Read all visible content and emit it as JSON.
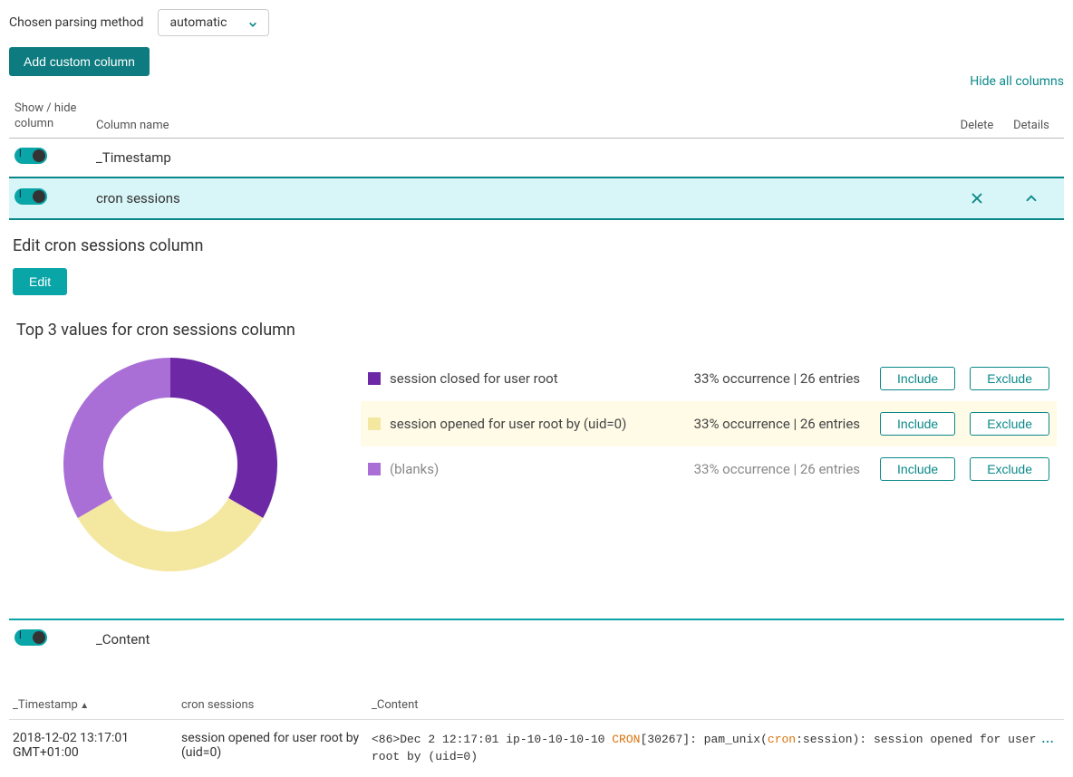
{
  "parse": {
    "label": "Chosen parsing method",
    "selected": "automatic"
  },
  "buttons": {
    "add_custom": "Add custom column",
    "hide_all": "Hide all columns",
    "edit": "Edit",
    "include": "Include",
    "exclude": "Exclude"
  },
  "column_list": {
    "headers": {
      "showhide": "Show / hide column",
      "name": "Column name",
      "delete": "Delete",
      "details": "Details"
    },
    "rows": [
      {
        "name": "_Timestamp",
        "selected": false,
        "deletable": false
      },
      {
        "name": "cron sessions",
        "selected": true,
        "deletable": true
      },
      {
        "name": "_Content",
        "selected": false,
        "deletable": false
      }
    ]
  },
  "edit_section": {
    "title": "Edit cron sessions column"
  },
  "top3": {
    "title": "Top 3 values for cron sessions column",
    "rows": [
      {
        "label": "session closed for user root",
        "stats": "33% occurrence | 26 entries",
        "color": "#6d28a5",
        "highlight": false,
        "muted": false
      },
      {
        "label": "session opened for user root by (uid=0)",
        "stats": "33% occurrence | 26 entries",
        "color": "#f4e7a0",
        "highlight": true,
        "muted": false
      },
      {
        "label": "(blanks)",
        "stats": "33% occurrence | 26 entries",
        "color": "#a96fd6",
        "highlight": false,
        "muted": true
      }
    ]
  },
  "data_table": {
    "headers": {
      "ts": "_Timestamp",
      "cron": "cron sessions",
      "content": "_Content"
    },
    "row": {
      "ts": "2018-12-02 13:17:01 GMT+01:00",
      "cron": "session opened for user root by (uid=0)",
      "c1": "<86>Dec  2 12:17:01 ip-10-10-10-10   ",
      "c2": "CRON",
      "c3": "[30267]:  pam_unix(",
      "c4": "cron",
      "c5": ":session): session opened for user root by (uid=0)"
    }
  },
  "chart_data": {
    "type": "pie",
    "inner_radius_ratio": 0.62,
    "series": [
      {
        "name": "session closed for user root",
        "value": 33.3,
        "entries": 26,
        "color": "#6d28a5"
      },
      {
        "name": "session opened for user root by (uid=0)",
        "value": 33.3,
        "entries": 26,
        "color": "#f4e7a0"
      },
      {
        "name": "(blanks)",
        "value": 33.3,
        "entries": 26,
        "color": "#a96fd6"
      }
    ]
  }
}
